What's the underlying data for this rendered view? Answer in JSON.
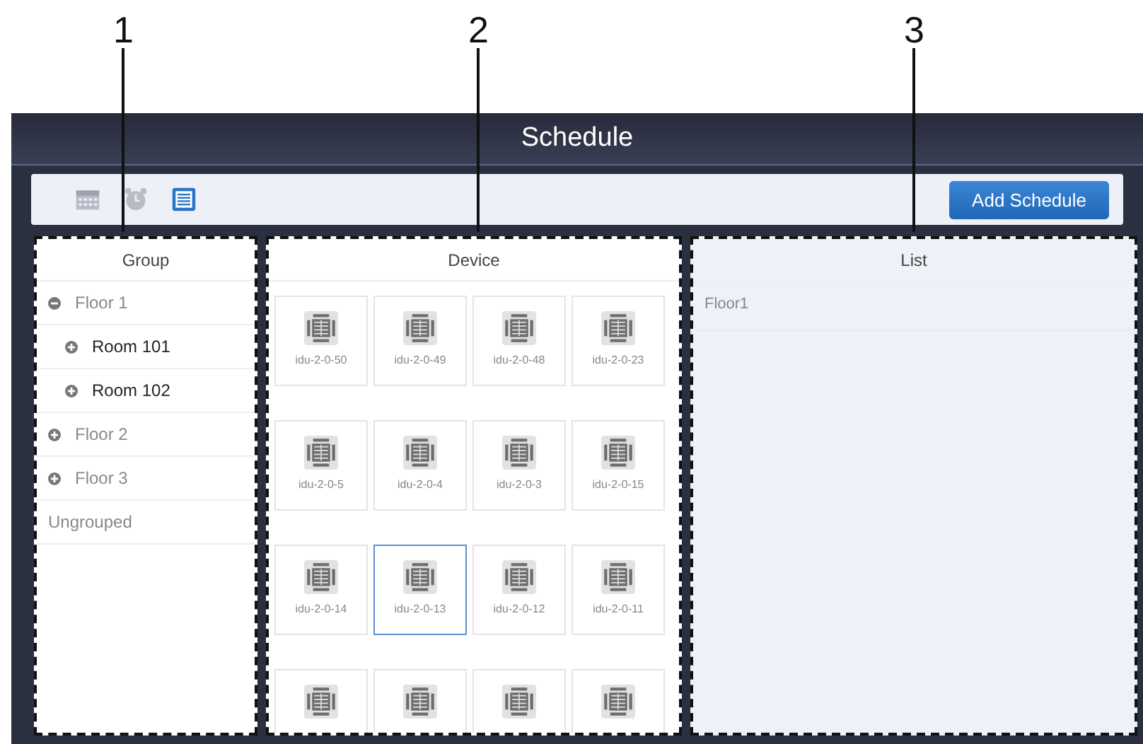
{
  "callouts": [
    {
      "label": "1"
    },
    {
      "label": "2"
    },
    {
      "label": "3"
    }
  ],
  "window": {
    "title": "Schedule"
  },
  "toolbar": {
    "views": [
      {
        "selected": false
      },
      {
        "selected": false
      },
      {
        "selected": true
      }
    ],
    "add_button": "Add Schedule"
  },
  "group_panel": {
    "title": "Group",
    "items": [
      {
        "kind": "node",
        "label": "Floor 1",
        "expanded": true,
        "children": [
          {
            "kind": "node",
            "label": "Room 101",
            "expanded": false
          },
          {
            "kind": "node",
            "label": "Room 102",
            "expanded": false
          }
        ]
      },
      {
        "kind": "node",
        "label": "Floor 2",
        "expanded": false
      },
      {
        "kind": "node",
        "label": "Floor 3",
        "expanded": false
      },
      {
        "kind": "leaf",
        "label": "Ungrouped"
      }
    ]
  },
  "device_panel": {
    "title": "Device",
    "devices": [
      {
        "label": "idu-2-0-50",
        "selected": false
      },
      {
        "label": "idu-2-0-49",
        "selected": false
      },
      {
        "label": "idu-2-0-48",
        "selected": false
      },
      {
        "label": "idu-2-0-23",
        "selected": false
      },
      {
        "label": "idu-2-0-5",
        "selected": false
      },
      {
        "label": "idu-2-0-4",
        "selected": false
      },
      {
        "label": "idu-2-0-3",
        "selected": false
      },
      {
        "label": "idu-2-0-15",
        "selected": false
      },
      {
        "label": "idu-2-0-14",
        "selected": false
      },
      {
        "label": "idu-2-0-13",
        "selected": true
      },
      {
        "label": "idu-2-0-12",
        "selected": false
      },
      {
        "label": "idu-2-0-11",
        "selected": false
      },
      {
        "selected": false
      },
      {
        "selected": false
      },
      {
        "selected": false
      },
      {
        "selected": false
      }
    ]
  },
  "list_panel": {
    "title": "List",
    "items": [
      "Floor1"
    ]
  }
}
